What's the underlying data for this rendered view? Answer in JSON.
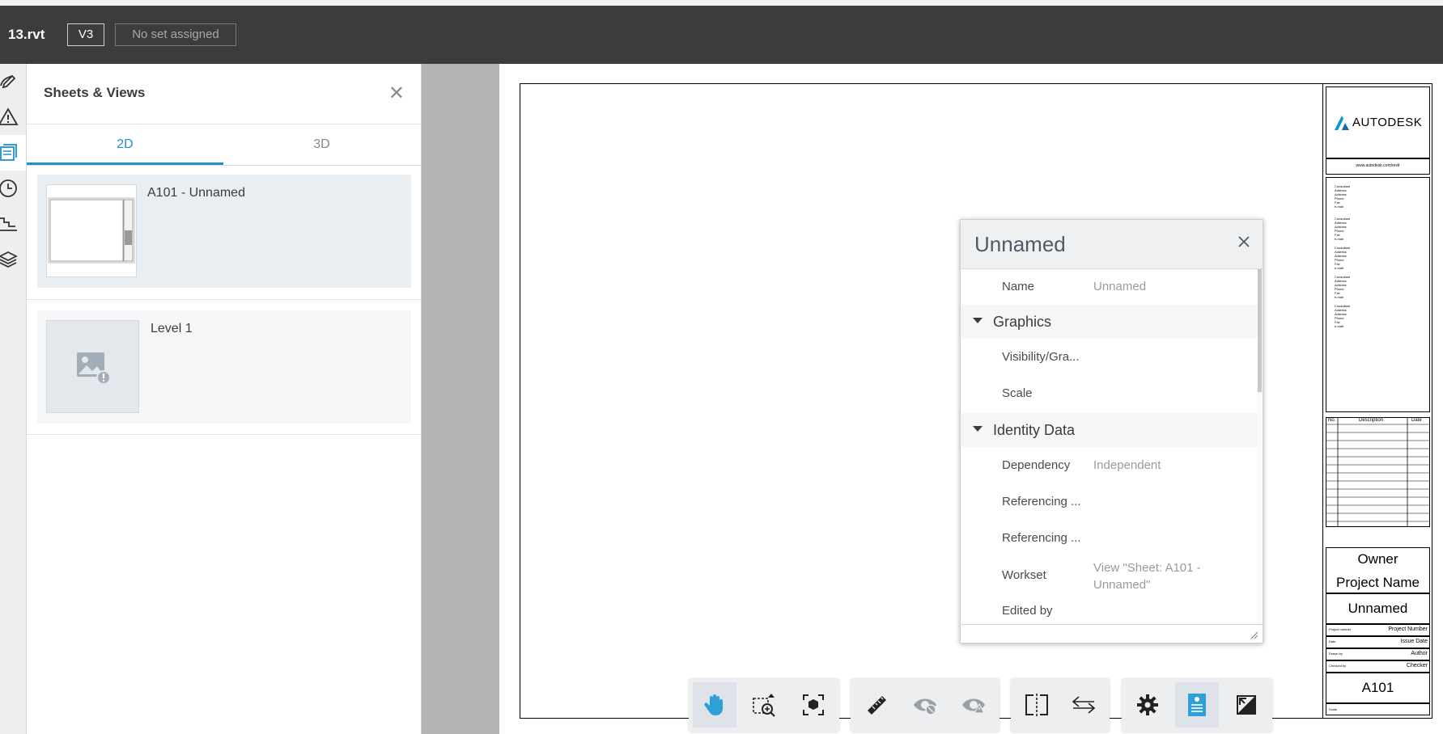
{
  "header": {
    "file_name": "13.rvt",
    "version": "V3",
    "set_status": "No set assigned"
  },
  "panel": {
    "title": "Sheets & Views",
    "tabs": [
      {
        "label": "2D",
        "active": true
      },
      {
        "label": "3D",
        "active": false
      }
    ],
    "items": [
      {
        "label": "A101 - Unnamed",
        "selected": true
      },
      {
        "label": "Level 1",
        "selected": false
      }
    ]
  },
  "properties": {
    "title": "Unnamed",
    "rows": {
      "name_label": "Name",
      "name_value": "Unnamed",
      "graphics_group": "Graphics",
      "visibility_label": "Visibility/Gra...",
      "scale_label": "Scale",
      "identity_group": "Identity Data",
      "dependency_label": "Dependency",
      "dependency_value": "Independent",
      "referencing1_label": "Referencing ...",
      "referencing2_label": "Referencing ...",
      "workset_label": "Workset",
      "workset_value": "View \"Sheet: A101 - Unnamed\"",
      "edited_by_label": "Edited by"
    }
  },
  "titleblock": {
    "logo_text": "AUTODESK",
    "website": "www.autodesk.com/revit",
    "consultant_block": [
      "Consultant",
      "Address",
      "Address",
      "Phone",
      "Fax",
      "e-mail"
    ],
    "revision_headers": [
      "No.",
      "Description",
      "Date"
    ],
    "owner": "Owner",
    "project_name": "Project Name",
    "sheet_name": "Unnamed",
    "meta_rows": [
      {
        "label": "Project number",
        "value": "Project Number"
      },
      {
        "label": "Date",
        "value": "Issue Date"
      },
      {
        "label": "Drawn by",
        "value": "Author"
      },
      {
        "label": "Checked by",
        "value": "Checker"
      }
    ],
    "sheet_number": "A101",
    "scale_label": "Scale"
  },
  "toolbar": {
    "accent_color": "#2f9fd8",
    "tools": [
      "pan-icon",
      "zoom-window-icon",
      "fit-to-view-icon",
      "measure-icon",
      "hide-icon",
      "isolate-icon",
      "split-view-icon",
      "compare-icon",
      "settings-icon",
      "properties-icon",
      "fullscreen-icon"
    ]
  }
}
